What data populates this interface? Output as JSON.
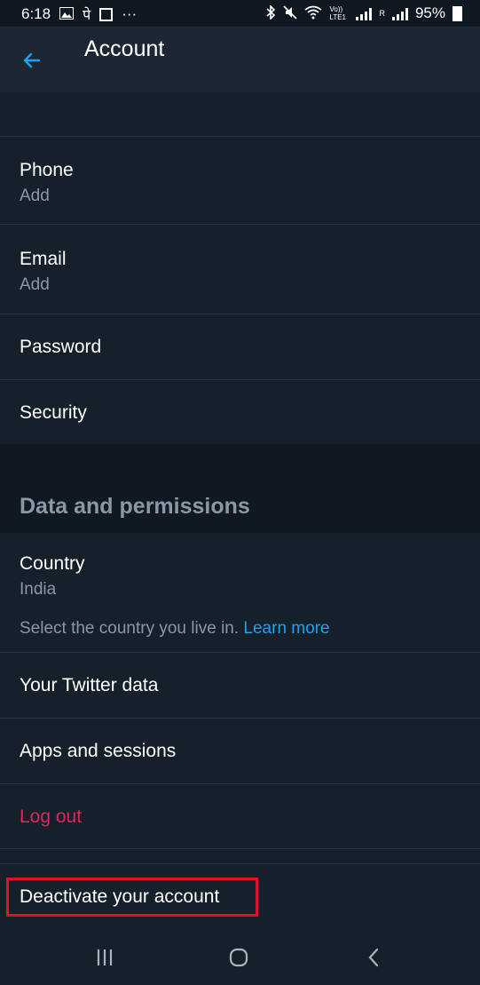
{
  "status_bar": {
    "time": "6:18",
    "carrier_glyph": "पे",
    "more": "···",
    "volte": "Vo)) LTE1",
    "sim": "R",
    "battery_text": "95%"
  },
  "app_bar": {
    "title": "Account",
    "back_icon": "arrow-left-icon"
  },
  "account_rows": [
    {
      "label": "Phone",
      "sub": "Add"
    },
    {
      "label": "Email",
      "sub": "Add"
    },
    {
      "label": "Password"
    },
    {
      "label": "Security"
    }
  ],
  "data_section": {
    "title": "Data and permissions",
    "country": {
      "label": "Country",
      "value": "India"
    },
    "note_text": "Select the country you live in.",
    "note_link": "Learn more",
    "rows": [
      "Your Twitter data",
      "Apps and sessions"
    ],
    "logout": "Log out"
  },
  "deactivate_label": "Deactivate your account",
  "colors": {
    "background": "#15202b",
    "appbar": "#1c2733",
    "accent": "#1da1f2",
    "danger": "#e0245e",
    "muted": "#8899a6",
    "highlight_box": "#e0102a"
  },
  "nav": {
    "recents_icon": "recents-icon",
    "home_icon": "home-icon",
    "back_icon": "nav-back-icon"
  }
}
